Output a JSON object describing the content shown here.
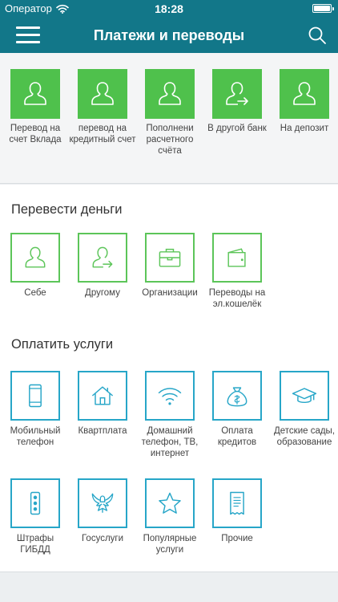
{
  "status_bar": {
    "carrier": "Оператор",
    "time": "18:28"
  },
  "header": {
    "title": "Платежи и переводы"
  },
  "quick_actions": [
    {
      "label": "Перевод на счет Вклада",
      "icon": "person-icon"
    },
    {
      "label": "перевод на кредитный счет",
      "icon": "person-icon"
    },
    {
      "label": "Пополнени расчетного счёта",
      "icon": "person-icon"
    },
    {
      "label": "В другой банк",
      "icon": "person-transfer-icon"
    },
    {
      "label": "На депозит",
      "icon": "person-icon"
    }
  ],
  "transfer": {
    "title": "Перевести деньги",
    "items": [
      {
        "label": "Себе",
        "icon": "person-icon"
      },
      {
        "label": "Другому",
        "icon": "person-transfer-icon"
      },
      {
        "label": "Организации",
        "icon": "briefcase-icon"
      },
      {
        "label": "Переводы на эл.кошелёк",
        "icon": "wallet-icon"
      }
    ]
  },
  "payments": {
    "title": "Оплатить услуги",
    "items": [
      {
        "label": "Мобильный телефон",
        "icon": "phone-icon"
      },
      {
        "label": "Квартплата",
        "icon": "house-icon"
      },
      {
        "label": "Домашний телефон, ТВ, интернет",
        "icon": "wifi-icon"
      },
      {
        "label": "Оплата кредитов",
        "icon": "money-bag-icon"
      },
      {
        "label": "Детские сады, образование",
        "icon": "graduation-cap-icon"
      },
      {
        "label": "Штрафы ГИБДД",
        "icon": "traffic-light-icon"
      },
      {
        "label": "Госуслуги",
        "icon": "eagle-emblem-icon"
      },
      {
        "label": "Популярные услуги",
        "icon": "star-icon"
      },
      {
        "label": "Прочие",
        "icon": "receipt-icon"
      }
    ]
  },
  "colors": {
    "header": "#127789",
    "quick_tile": "#4fc14c",
    "transfer_border": "#5cc559",
    "payment_border": "#27a6c8"
  }
}
